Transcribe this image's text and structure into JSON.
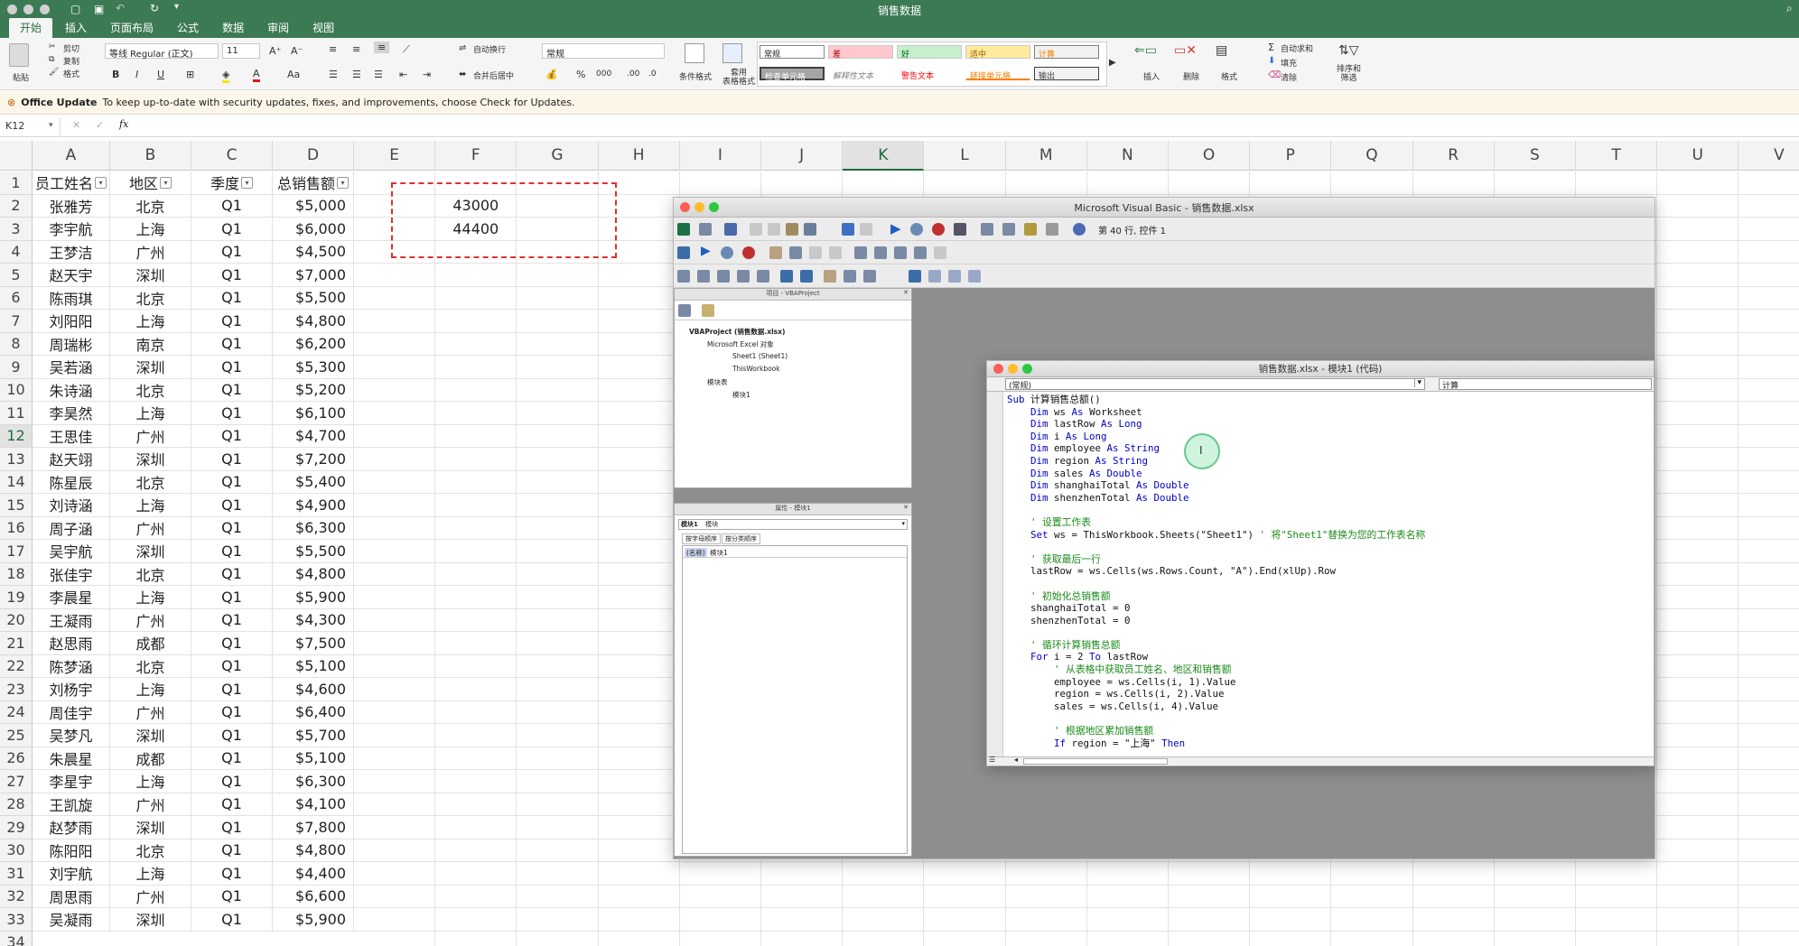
{
  "window": {
    "title": "销售数据"
  },
  "ribbon": {
    "tabs": [
      "开始",
      "插入",
      "页面布局",
      "公式",
      "数据",
      "审阅",
      "视图"
    ],
    "clipboard": {
      "paste": "粘贴",
      "cut": "剪切",
      "copy": "复制",
      "format": "格式"
    },
    "font_name": "等线 Regular (正文)",
    "font_size": "11",
    "wrap_text": "自动换行",
    "merge_center": "合并后居中",
    "number_format": "常规",
    "conditional_format": "条件格式",
    "table_format": "套用\n表格格式",
    "styles": [
      "常规",
      "差",
      "好",
      "适中",
      "计算",
      "检查单元格",
      "解释性文本",
      "警告文本",
      "链接单元格",
      "输出"
    ],
    "insert": "插入",
    "delete": "删除",
    "format": "格式",
    "autosum": "自动求和",
    "fill": "填充",
    "clear": "清除",
    "sort_filter": "排序和\n筛选"
  },
  "update_bar": {
    "title": "Office Update",
    "message": "To keep up-to-date with security updates, fixes, and improvements, choose Check for Updates."
  },
  "formula_bar": {
    "name_box": "K12",
    "fx": "fx",
    "content": ""
  },
  "sheet": {
    "columns": [
      "A",
      "B",
      "C",
      "D",
      "E",
      "F",
      "G",
      "H",
      "I",
      "J",
      "K",
      "L",
      "M",
      "N",
      "O",
      "P",
      "Q",
      "R",
      "S",
      "T",
      "U",
      "V"
    ],
    "selected_column": "K",
    "selected_row": "12",
    "row_numbers": [
      "1",
      "2",
      "3",
      "4",
      "5",
      "6",
      "7",
      "8",
      "9",
      "10",
      "11",
      "12",
      "13",
      "14",
      "15",
      "16",
      "17",
      "18",
      "19",
      "20",
      "21",
      "22",
      "23",
      "24",
      "25",
      "26",
      "27",
      "28",
      "29",
      "30",
      "31",
      "32",
      "33",
      "34"
    ],
    "headers": [
      "员工姓名",
      "地区",
      "季度",
      "总销售额"
    ],
    "rows": [
      [
        "张雅芳",
        "北京",
        "Q1",
        "$5,000"
      ],
      [
        "李宇航",
        "上海",
        "Q1",
        "$6,000"
      ],
      [
        "王梦洁",
        "广州",
        "Q1",
        "$4,500"
      ],
      [
        "赵天宇",
        "深圳",
        "Q1",
        "$7,000"
      ],
      [
        "陈雨琪",
        "北京",
        "Q1",
        "$5,500"
      ],
      [
        "刘阳阳",
        "上海",
        "Q1",
        "$4,800"
      ],
      [
        "周瑞彬",
        "南京",
        "Q1",
        "$6,200"
      ],
      [
        "吴若涵",
        "深圳",
        "Q1",
        "$5,300"
      ],
      [
        "朱诗涵",
        "北京",
        "Q1",
        "$5,200"
      ],
      [
        "李昊然",
        "上海",
        "Q1",
        "$6,100"
      ],
      [
        "王思佳",
        "广州",
        "Q1",
        "$4,700"
      ],
      [
        "赵天翊",
        "深圳",
        "Q1",
        "$7,200"
      ],
      [
        "陈星辰",
        "北京",
        "Q1",
        "$5,400"
      ],
      [
        "刘诗涵",
        "上海",
        "Q1",
        "$4,900"
      ],
      [
        "周子涵",
        "广州",
        "Q1",
        "$6,300"
      ],
      [
        "吴宇航",
        "深圳",
        "Q1",
        "$5,500"
      ],
      [
        "张佳宇",
        "北京",
        "Q1",
        "$4,800"
      ],
      [
        "李晨星",
        "上海",
        "Q1",
        "$5,900"
      ],
      [
        "王凝雨",
        "广州",
        "Q1",
        "$4,300"
      ],
      [
        "赵思雨",
        "成都",
        "Q1",
        "$7,500"
      ],
      [
        "陈梦涵",
        "北京",
        "Q1",
        "$5,100"
      ],
      [
        "刘杨宇",
        "上海",
        "Q1",
        "$4,600"
      ],
      [
        "周佳宇",
        "广州",
        "Q1",
        "$6,400"
      ],
      [
        "吴梦凡",
        "深圳",
        "Q1",
        "$5,700"
      ],
      [
        "朱晨星",
        "成都",
        "Q1",
        "$5,100"
      ],
      [
        "李星宇",
        "上海",
        "Q1",
        "$6,300"
      ],
      [
        "王凯旋",
        "广州",
        "Q1",
        "$4,100"
      ],
      [
        "赵梦雨",
        "深圳",
        "Q1",
        "$7,800"
      ],
      [
        "陈阳阳",
        "北京",
        "Q1",
        "$4,800"
      ],
      [
        "刘宇航",
        "上海",
        "Q1",
        "$4,400"
      ],
      [
        "周思雨",
        "广州",
        "Q1",
        "$6,600"
      ],
      [
        "吴凝雨",
        "深圳",
        "Q1",
        "$5,900"
      ]
    ],
    "results": [
      "43000",
      "44400"
    ]
  },
  "vbe": {
    "title": "Microsoft Visual Basic - 销售数据.xlsx",
    "status": "第 40 行, 控件 1",
    "project_pane_title": "项目 - VBAProject",
    "project_tree": [
      "VBAProject (销售数据.xlsx)",
      "Microsoft Excel 对象",
      "Sheet1 (Sheet1)",
      "ThisWorkbook",
      "模块表",
      "模块1"
    ],
    "props_pane_title": "属性 - 模块1",
    "props_object": "模块1",
    "props_object_type": "模块",
    "props_tabs": [
      "按字母顺序",
      "按分类顺序"
    ],
    "props_name_key": "(名称)",
    "props_name_value": "模块1",
    "code_window": {
      "title": "销售数据.xlsx - 模块1 (代码)",
      "object_dropdown": "(常规)",
      "proc_dropdown": "计算"
    }
  }
}
